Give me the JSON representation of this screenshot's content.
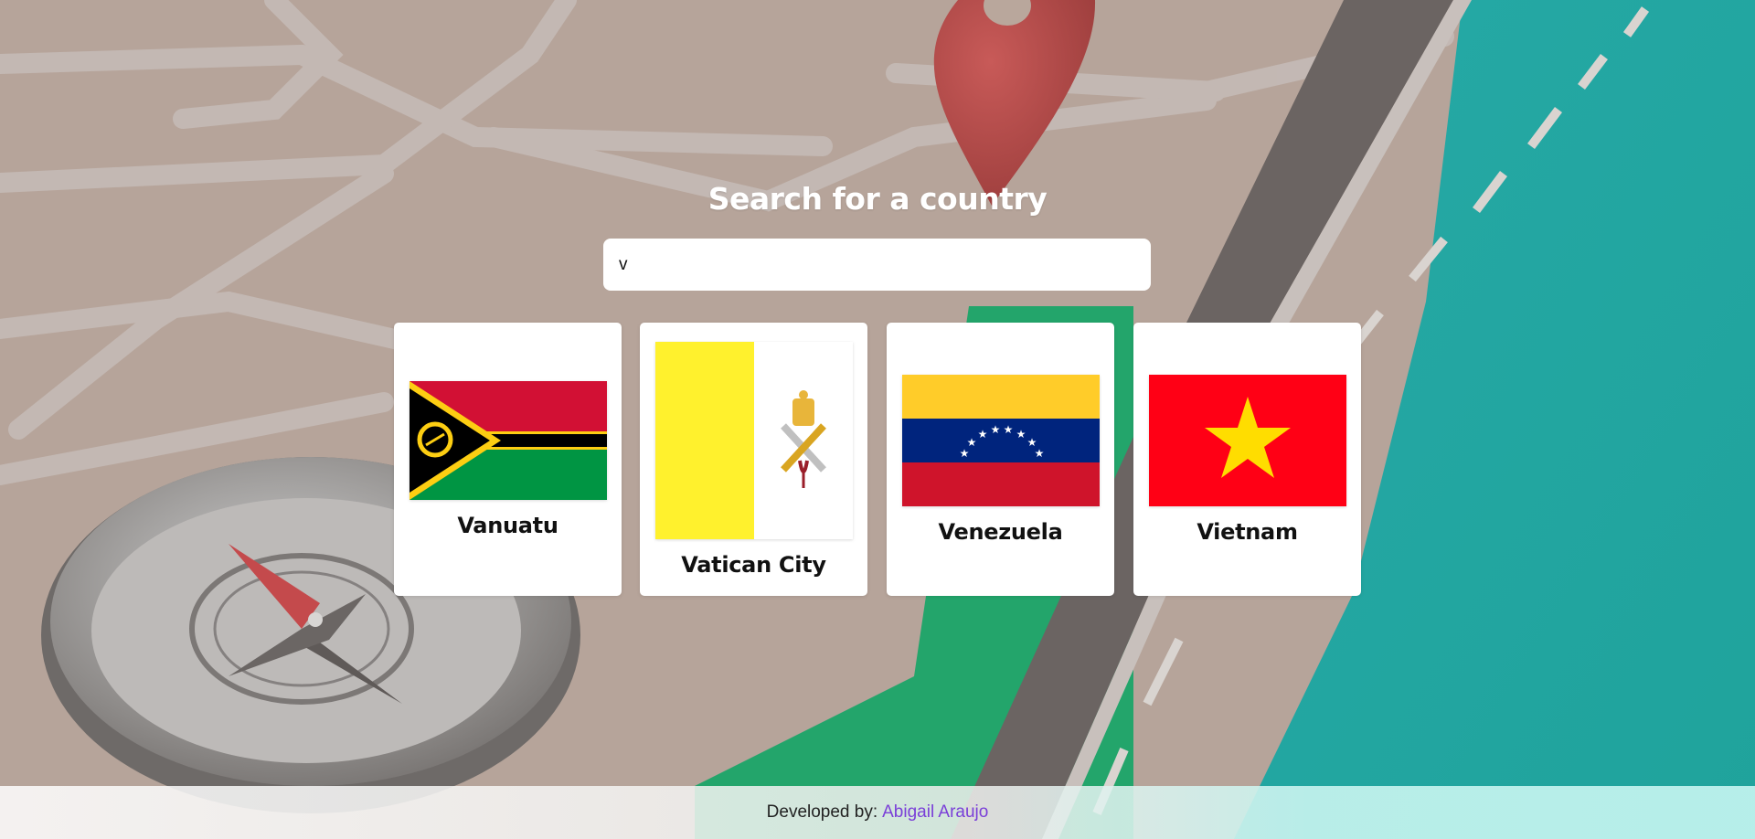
{
  "heading": "Search for a country",
  "search": {
    "value": "v"
  },
  "countries": [
    {
      "name": "Vanuatu"
    },
    {
      "name": "Vatican City"
    },
    {
      "name": "Venezuela"
    },
    {
      "name": "Vietnam"
    }
  ],
  "footer": {
    "label": "Developed by:",
    "author": "Abigail Araujo"
  },
  "colors": {
    "footer_link": "#7a3fd8",
    "card_bg": "#ffffff"
  }
}
